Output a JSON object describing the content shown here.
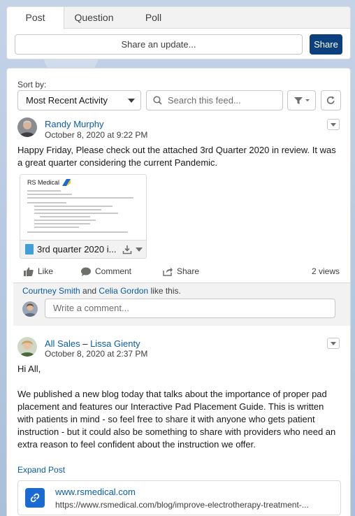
{
  "publisher": {
    "tabs": [
      "Post",
      "Question",
      "Poll"
    ],
    "share_placeholder": "Share an update...",
    "share_button": "Share"
  },
  "feed": {
    "sort_label": "Sort by:",
    "sort_value": "Most Recent Activity",
    "search_placeholder": "Search this feed...",
    "posts": [
      {
        "author": "Randy Murphy",
        "timestamp": "October 8, 2020 at 9:22 PM",
        "body": "Happy Friday, Please check out the attached 3rd Quarter 2020 in review. It was a great quarter considering the current Pandemic.",
        "attachment": {
          "preview_title": "RS Medical",
          "file_name": "3rd quarter 2020 i..."
        },
        "actions": {
          "like": "Like",
          "comment": "Comment",
          "share": "Share"
        },
        "views": "2 views",
        "likers": [
          "Courtney Smith",
          "Celia Gordon"
        ],
        "likers_and": "and",
        "likers_suffix": "like this.",
        "comment_placeholder": "Write a comment..."
      },
      {
        "group": "All Sales",
        "separator": "–",
        "author": "Lissa Gienty",
        "timestamp": "October 8, 2020 at 2:37 PM",
        "greeting": "Hi All,",
        "body": "We published a new blog today that talks about the importance of proper pad placement and features our Interactive Pad Placement Guide. This is written with patients in mind - so feel free to share it with anyone who gets patient instruction - but it could also be something to share with providers who need an extra reason to feel confident about the instruction we offer.",
        "expand_label": "Expand Post",
        "link": {
          "title": "www.rsmedical.com",
          "url": "https://www.rsmedical.com/blog/improve-electrotherapy-treatment-..."
        }
      }
    ]
  }
}
